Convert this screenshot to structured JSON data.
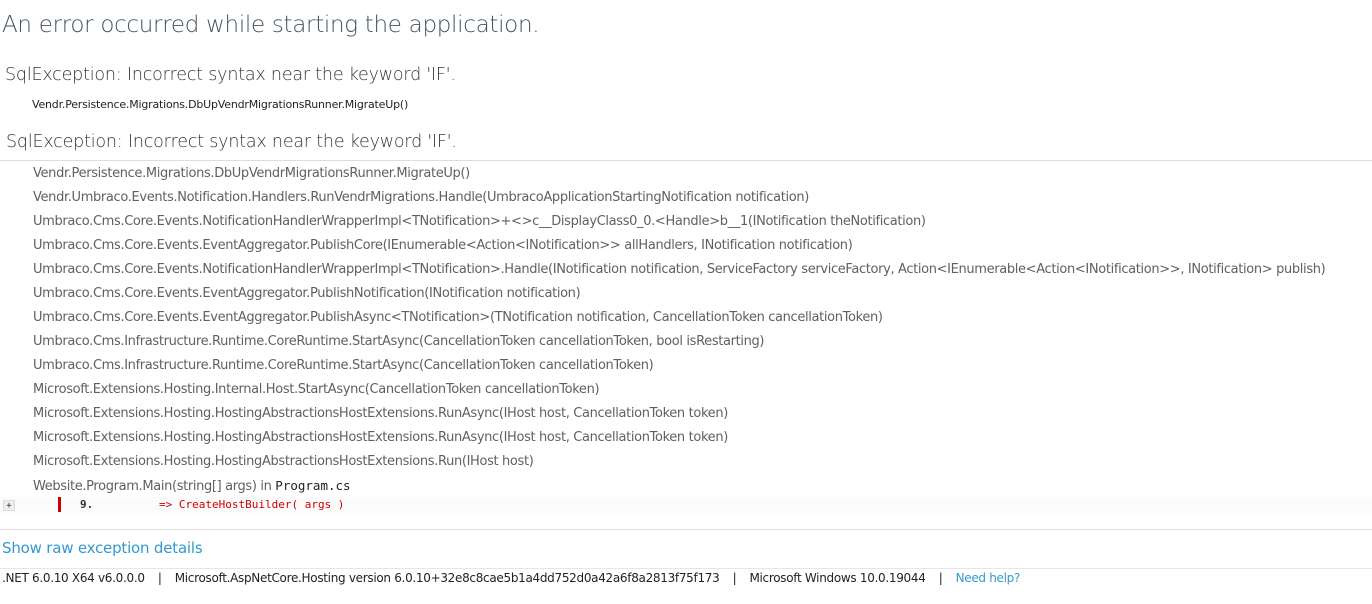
{
  "title": "An error occurred while starting the application.",
  "exceptions": [
    {
      "heading": "SqlException: Incorrect syntax near the keyword 'IF'.",
      "location": "Vendr.Persistence.Migrations.DbUpVendrMigrationsRunner.MigrateUp()"
    },
    {
      "heading": "SqlException: Incorrect syntax near the keyword 'IF'."
    }
  ],
  "stack_frames": [
    "Vendr.Persistence.Migrations.DbUpVendrMigrationsRunner.MigrateUp()",
    "Vendr.Umbraco.Events.Notification.Handlers.RunVendrMigrations.Handle(UmbracoApplicationStartingNotification notification)",
    "Umbraco.Cms.Core.Events.NotificationHandlerWrapperImpl<TNotification>+<>c__DisplayClass0_0.<Handle>b__1(INotification theNotification)",
    "Umbraco.Cms.Core.Events.EventAggregator.PublishCore(IEnumerable<Action<INotification>> allHandlers, INotification notification)",
    "Umbraco.Cms.Core.Events.NotificationHandlerWrapperImpl<TNotification>.Handle(INotification notification, ServiceFactory serviceFactory, Action<IEnumerable<Action<INotification>>, INotification> publish)",
    "Umbraco.Cms.Core.Events.EventAggregator.PublishNotification(INotification notification)",
    "Umbraco.Cms.Core.Events.EventAggregator.PublishAsync<TNotification>(TNotification notification, CancellationToken cancellationToken)",
    "Umbraco.Cms.Infrastructure.Runtime.CoreRuntime.StartAsync(CancellationToken cancellationToken, bool isRestarting)",
    "Umbraco.Cms.Infrastructure.Runtime.CoreRuntime.StartAsync(CancellationToken cancellationToken)",
    "Microsoft.Extensions.Hosting.Internal.Host.StartAsync(CancellationToken cancellationToken)",
    "Microsoft.Extensions.Hosting.HostingAbstractionsHostExtensions.RunAsync(IHost host, CancellationToken token)",
    "Microsoft.Extensions.Hosting.HostingAbstractionsHostExtensions.RunAsync(IHost host, CancellationToken token)",
    "Microsoft.Extensions.Hosting.HostingAbstractionsHostExtensions.Run(IHost host)"
  ],
  "last_frame": {
    "method": "Website.Program.Main(string[] args)",
    "in_label": " in ",
    "file": "Program.cs"
  },
  "source": {
    "expander": "+",
    "line_number": "9.",
    "code": "=> CreateHostBuilder( args )"
  },
  "raw_exception_link": "Show raw exception details",
  "footer": {
    "runtime": ".NET 6.0.10 X64 v6.0.0.0",
    "hosting": "Microsoft.AspNetCore.Hosting version 6.0.10+32e8c8cae5b1a4dd752d0a42a6f8a2813f75f173",
    "os": "Microsoft Windows 10.0.19044",
    "help_link": "Need help?",
    "separator": "|"
  },
  "colors": {
    "link": "#3399cc",
    "error_code": "#cc0000",
    "title": "#44525e"
  }
}
